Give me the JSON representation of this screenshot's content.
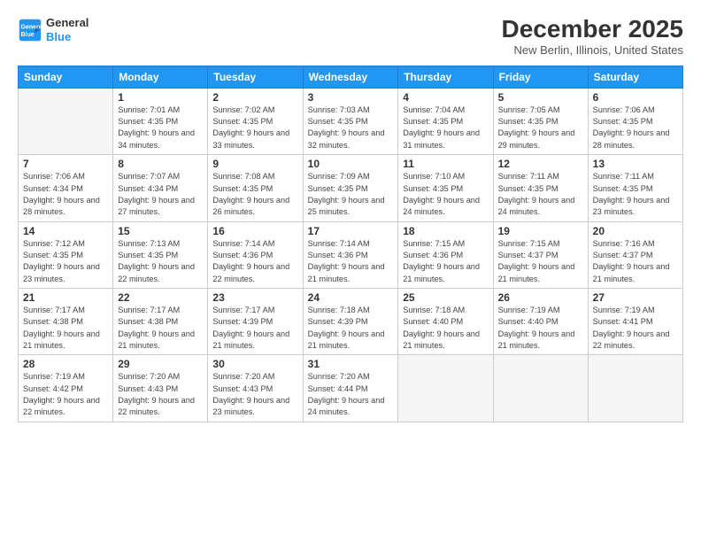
{
  "header": {
    "logo_line1": "General",
    "logo_line2": "Blue",
    "month": "December 2025",
    "location": "New Berlin, Illinois, United States"
  },
  "weekdays": [
    "Sunday",
    "Monday",
    "Tuesday",
    "Wednesday",
    "Thursday",
    "Friday",
    "Saturday"
  ],
  "weeks": [
    [
      {
        "day": "",
        "empty": true
      },
      {
        "day": "1",
        "sunrise": "7:01 AM",
        "sunset": "4:35 PM",
        "daylight": "9 hours and 34 minutes."
      },
      {
        "day": "2",
        "sunrise": "7:02 AM",
        "sunset": "4:35 PM",
        "daylight": "9 hours and 33 minutes."
      },
      {
        "day": "3",
        "sunrise": "7:03 AM",
        "sunset": "4:35 PM",
        "daylight": "9 hours and 32 minutes."
      },
      {
        "day": "4",
        "sunrise": "7:04 AM",
        "sunset": "4:35 PM",
        "daylight": "9 hours and 31 minutes."
      },
      {
        "day": "5",
        "sunrise": "7:05 AM",
        "sunset": "4:35 PM",
        "daylight": "9 hours and 29 minutes."
      },
      {
        "day": "6",
        "sunrise": "7:06 AM",
        "sunset": "4:35 PM",
        "daylight": "9 hours and 28 minutes."
      }
    ],
    [
      {
        "day": "7",
        "sunrise": "7:06 AM",
        "sunset": "4:34 PM",
        "daylight": "9 hours and 28 minutes."
      },
      {
        "day": "8",
        "sunrise": "7:07 AM",
        "sunset": "4:34 PM",
        "daylight": "9 hours and 27 minutes."
      },
      {
        "day": "9",
        "sunrise": "7:08 AM",
        "sunset": "4:35 PM",
        "daylight": "9 hours and 26 minutes."
      },
      {
        "day": "10",
        "sunrise": "7:09 AM",
        "sunset": "4:35 PM",
        "daylight": "9 hours and 25 minutes."
      },
      {
        "day": "11",
        "sunrise": "7:10 AM",
        "sunset": "4:35 PM",
        "daylight": "9 hours and 24 minutes."
      },
      {
        "day": "12",
        "sunrise": "7:11 AM",
        "sunset": "4:35 PM",
        "daylight": "9 hours and 24 minutes."
      },
      {
        "day": "13",
        "sunrise": "7:11 AM",
        "sunset": "4:35 PM",
        "daylight": "9 hours and 23 minutes."
      }
    ],
    [
      {
        "day": "14",
        "sunrise": "7:12 AM",
        "sunset": "4:35 PM",
        "daylight": "9 hours and 23 minutes."
      },
      {
        "day": "15",
        "sunrise": "7:13 AM",
        "sunset": "4:35 PM",
        "daylight": "9 hours and 22 minutes."
      },
      {
        "day": "16",
        "sunrise": "7:14 AM",
        "sunset": "4:36 PM",
        "daylight": "9 hours and 22 minutes."
      },
      {
        "day": "17",
        "sunrise": "7:14 AM",
        "sunset": "4:36 PM",
        "daylight": "9 hours and 21 minutes."
      },
      {
        "day": "18",
        "sunrise": "7:15 AM",
        "sunset": "4:36 PM",
        "daylight": "9 hours and 21 minutes."
      },
      {
        "day": "19",
        "sunrise": "7:15 AM",
        "sunset": "4:37 PM",
        "daylight": "9 hours and 21 minutes."
      },
      {
        "day": "20",
        "sunrise": "7:16 AM",
        "sunset": "4:37 PM",
        "daylight": "9 hours and 21 minutes."
      }
    ],
    [
      {
        "day": "21",
        "sunrise": "7:17 AM",
        "sunset": "4:38 PM",
        "daylight": "9 hours and 21 minutes."
      },
      {
        "day": "22",
        "sunrise": "7:17 AM",
        "sunset": "4:38 PM",
        "daylight": "9 hours and 21 minutes."
      },
      {
        "day": "23",
        "sunrise": "7:17 AM",
        "sunset": "4:39 PM",
        "daylight": "9 hours and 21 minutes."
      },
      {
        "day": "24",
        "sunrise": "7:18 AM",
        "sunset": "4:39 PM",
        "daylight": "9 hours and 21 minutes."
      },
      {
        "day": "25",
        "sunrise": "7:18 AM",
        "sunset": "4:40 PM",
        "daylight": "9 hours and 21 minutes."
      },
      {
        "day": "26",
        "sunrise": "7:19 AM",
        "sunset": "4:40 PM",
        "daylight": "9 hours and 21 minutes."
      },
      {
        "day": "27",
        "sunrise": "7:19 AM",
        "sunset": "4:41 PM",
        "daylight": "9 hours and 22 minutes."
      }
    ],
    [
      {
        "day": "28",
        "sunrise": "7:19 AM",
        "sunset": "4:42 PM",
        "daylight": "9 hours and 22 minutes."
      },
      {
        "day": "29",
        "sunrise": "7:20 AM",
        "sunset": "4:43 PM",
        "daylight": "9 hours and 22 minutes."
      },
      {
        "day": "30",
        "sunrise": "7:20 AM",
        "sunset": "4:43 PM",
        "daylight": "9 hours and 23 minutes."
      },
      {
        "day": "31",
        "sunrise": "7:20 AM",
        "sunset": "4:44 PM",
        "daylight": "9 hours and 24 minutes."
      },
      {
        "day": "",
        "empty": true
      },
      {
        "day": "",
        "empty": true
      },
      {
        "day": "",
        "empty": true
      }
    ]
  ]
}
